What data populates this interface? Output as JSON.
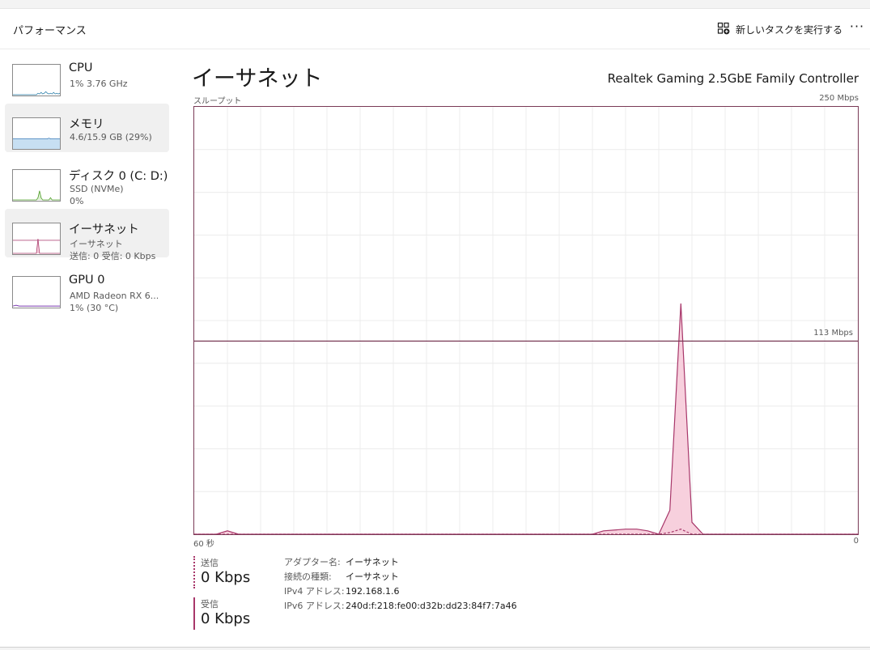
{
  "header": {
    "title": "パフォーマンス",
    "run_task_label": "新しいタスクを実行する",
    "more_label": "···"
  },
  "sidebar": {
    "items": [
      {
        "name": "CPU",
        "sub1": "1%  3.76 GHz",
        "sub2": "",
        "selected": false,
        "color": "#2a7ea8"
      },
      {
        "name": "メモリ",
        "sub1": "4.6/15.9 GB (29%)",
        "sub2": "",
        "selected": true,
        "color": "#2e75b6"
      },
      {
        "name": "ディスク 0 (C: D:)",
        "sub1": "SSD (NVMe)",
        "sub2": "0%",
        "selected": false,
        "color": "#4a9a23"
      },
      {
        "name": "イーサネット",
        "sub1": "イーサネット",
        "sub2": "送信: 0  受信: 0 Kbps",
        "selected": true,
        "color": "#a8376a"
      },
      {
        "name": "GPU 0",
        "sub1": "AMD Radeon RX 6...",
        "sub2": "1%  (30 °C)",
        "selected": false,
        "color": "#7a3ab0"
      }
    ]
  },
  "main": {
    "title": "イーサネット",
    "adapter": "Realtek Gaming 2.5GbE Family Controller",
    "throughput_label": "スループット",
    "max_label": "250 Mbps",
    "scale_label": "113 Mbps",
    "x_left_label": "60 秒",
    "x_right_label": "0"
  },
  "chart_data": {
    "type": "area",
    "title": "",
    "ylabel": "スループット",
    "ylim": [
      0,
      250
    ],
    "xlim": [
      60,
      0
    ],
    "x_label_left": "60 秒",
    "x_label_right": "0",
    "y_max_label": "250 Mbps",
    "reference_line": {
      "value": 113,
      "label": "113 Mbps"
    },
    "grid": true,
    "series": [
      {
        "name": "受信",
        "style": "solid",
        "color": "#a8376a",
        "fill": "#f7d0dd",
        "x": [
          60,
          58,
          57,
          56,
          55,
          24,
          23,
          21,
          20,
          19,
          18,
          17,
          16,
          15,
          14,
          13,
          0
        ],
        "values": [
          0,
          0,
          2,
          0,
          0,
          0,
          2,
          3,
          3,
          2,
          0,
          14,
          135,
          7,
          0,
          0,
          0
        ]
      },
      {
        "name": "送信",
        "style": "dashed",
        "color": "#a8376a",
        "x": [
          60,
          18,
          17,
          16,
          15,
          0
        ],
        "values": [
          0,
          0,
          1,
          3,
          0,
          0
        ]
      }
    ]
  },
  "stats": {
    "send_label": "送信",
    "send_value": "0 Kbps",
    "recv_label": "受信",
    "recv_value": "0 Kbps"
  },
  "properties": [
    {
      "key": "アダプター名:",
      "value": "イーサネット"
    },
    {
      "key": "接続の種類:",
      "value": "イーサネット"
    },
    {
      "key": "IPv4 アドレス:",
      "value": "192.168.1.6"
    },
    {
      "key": "IPv6 アドレス:",
      "value": "240d:f:218:fe00:d32b:dd23:84f7:7a46"
    }
  ]
}
